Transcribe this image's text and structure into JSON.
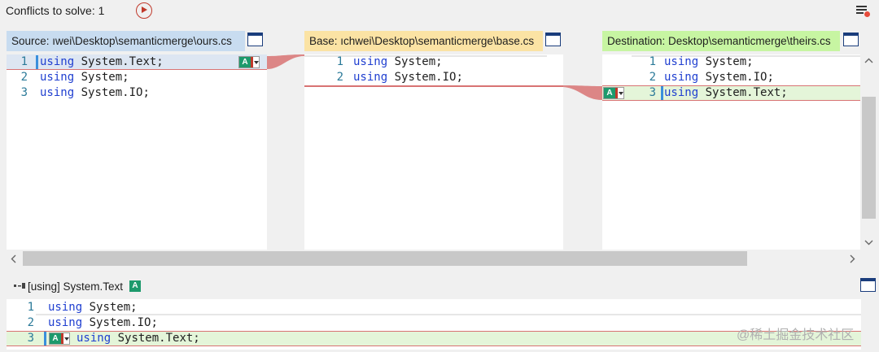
{
  "toolbar": {
    "conflicts_label": "Conflicts to solve: 1"
  },
  "panels": {
    "source": {
      "title": "Source: ıwei\\Desktop\\semanticmerge\\ours.cs",
      "title_bg": "#c8dcf0",
      "lines": [
        {
          "num": "1",
          "kw": "using",
          "rest": " System.Text;"
        },
        {
          "num": "2",
          "kw": "using",
          "rest": " System;"
        },
        {
          "num": "3",
          "kw": "using",
          "rest": " System.IO;"
        }
      ]
    },
    "base": {
      "title": "Base: ıchwei\\Desktop\\semanticmerge\\base.cs",
      "title_bg": "#fbe3a4",
      "lines": [
        {
          "num": "1",
          "kw": "using",
          "rest": " System;"
        },
        {
          "num": "2",
          "kw": "using",
          "rest": " System.IO;"
        }
      ]
    },
    "destination": {
      "title": "Destination: Desktop\\semanticmerge\\theirs.cs",
      "title_bg": "#c7f5a2",
      "lines": [
        {
          "num": "1",
          "kw": "using",
          "rest": " System;"
        },
        {
          "num": "2",
          "kw": "using",
          "rest": " System.IO;"
        },
        {
          "num": "3",
          "kw": "using",
          "rest": " System.Text;"
        }
      ]
    }
  },
  "badge": {
    "letter": "A"
  },
  "result": {
    "title": "[using] System.Text",
    "lines": [
      {
        "num": "1",
        "kw": "using",
        "rest": " System;"
      },
      {
        "num": "2",
        "kw": "using",
        "rest": " System.IO;"
      },
      {
        "num": "3",
        "kw": "using",
        "rest": " System.Text;"
      }
    ]
  },
  "watermark": "@稀土掘金技术社区",
  "colors": {
    "conflict": "#d87373",
    "keyword": "#1f3fd0",
    "line_number": "#2b7a99",
    "accent_green": "#1d9a6c"
  }
}
